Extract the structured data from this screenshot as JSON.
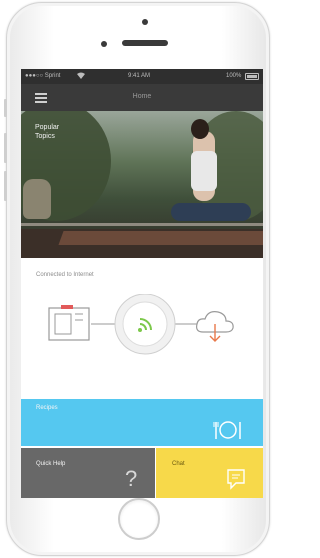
{
  "status_bar": {
    "carrier": "●●●○○ Sprint",
    "wifi": "wifi",
    "time": "9:41 AM",
    "battery": "100%"
  },
  "nav": {
    "title": "Home",
    "menu_icon": "hamburger-icon"
  },
  "hero": {
    "label_line1": "Popular",
    "label_line2": "Topics"
  },
  "connection": {
    "status_text": "Connected to Internet",
    "icons": [
      "appliance-icon",
      "wifi-icon",
      "cloud-download-icon"
    ]
  },
  "tiles": {
    "recipes": {
      "label": "Recipes",
      "icon": "dish-utensils-icon"
    },
    "quick_help": {
      "label": "Quick Help",
      "glyph": "?"
    },
    "chat": {
      "label": "Chat",
      "icon": "chat-bubble-icon"
    }
  },
  "colors": {
    "recipes_tile": "#55c8f0",
    "quick_help_tile": "#686868",
    "chat_tile": "#f7d94a",
    "wifi_accent": "#7cc84a",
    "download_accent": "#e8784a"
  }
}
